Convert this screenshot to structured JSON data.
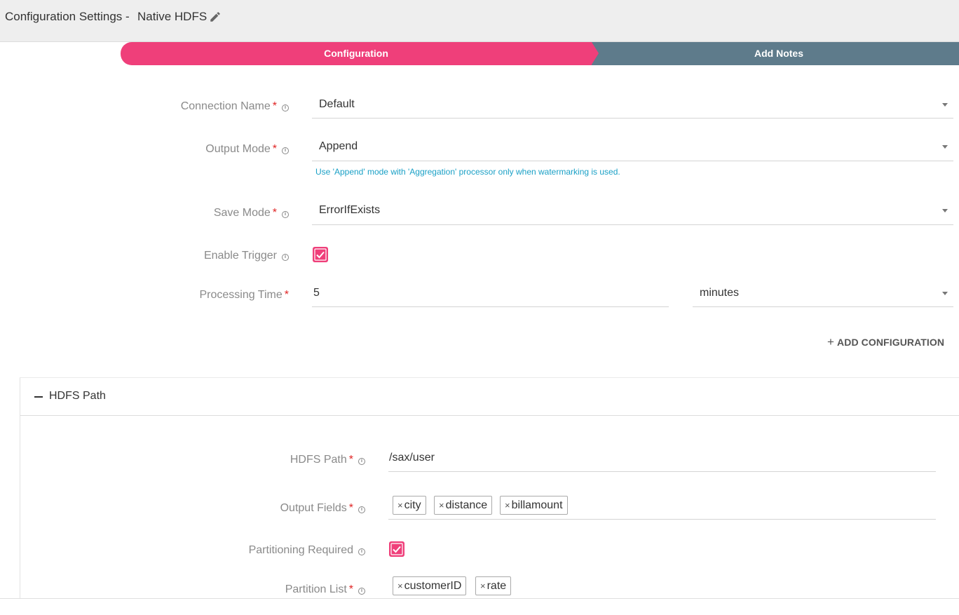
{
  "header": {
    "title": "Configuration Settings -",
    "subtitle": "Native HDFS",
    "edit_icon": "pencil-icon"
  },
  "stepper": {
    "steps": [
      {
        "label": "Configuration",
        "active": true,
        "color": "#ef3f7a"
      },
      {
        "label": "Add Notes",
        "active": false,
        "color": "#5e7b8b"
      }
    ]
  },
  "form": {
    "connection_name": {
      "label": "Connection Name",
      "value": "Default"
    },
    "output_mode": {
      "label": "Output Mode",
      "value": "Append",
      "hint": "Use 'Append' mode with 'Aggregation' processor only when watermarking is used."
    },
    "save_mode": {
      "label": "Save Mode",
      "value": "ErrorIfExists"
    },
    "enable_trigger": {
      "label": "Enable Trigger",
      "checked": true
    },
    "processing_time": {
      "label": "Processing Time",
      "value": "5",
      "unit": "minutes"
    },
    "add_configuration": "ADD CONFIGURATION"
  },
  "hdfs_panel": {
    "title": "HDFS Path",
    "hdfs_path": {
      "label": "HDFS Path",
      "value": "/sax/user"
    },
    "output_fields": {
      "label": "Output Fields",
      "tags": [
        "city",
        "distance",
        "billamount"
      ]
    },
    "partitioning_required": {
      "label": "Partitioning Required",
      "checked": true
    },
    "partition_list": {
      "label": "Partition List",
      "tags": [
        "customerID",
        "rate"
      ]
    }
  },
  "symbols": {
    "required": "*",
    "info": "i",
    "remove": "×",
    "plus": "+"
  },
  "colors": {
    "accent": "#ef3f7a",
    "secondary": "#5e7b8b",
    "hint": "#1aa0c6",
    "required": "#e02424"
  }
}
